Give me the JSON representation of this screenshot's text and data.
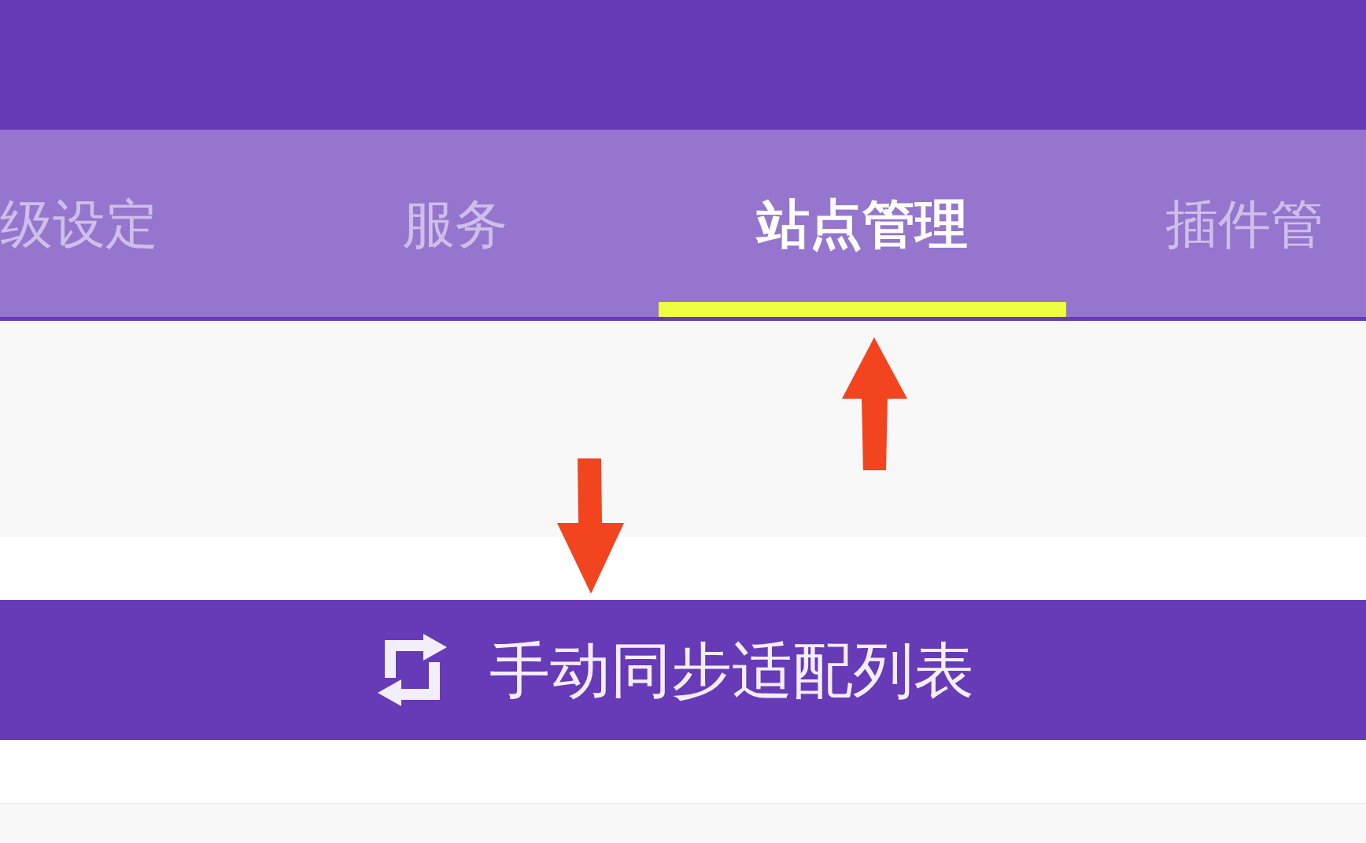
{
  "tabs": [
    {
      "label": "级设定",
      "selected": false
    },
    {
      "label": "服务",
      "selected": false
    },
    {
      "label": "站点管理",
      "selected": true
    },
    {
      "label": "插件管",
      "selected": false
    }
  ],
  "sync_button": {
    "label": "手动同步适配列表"
  }
}
